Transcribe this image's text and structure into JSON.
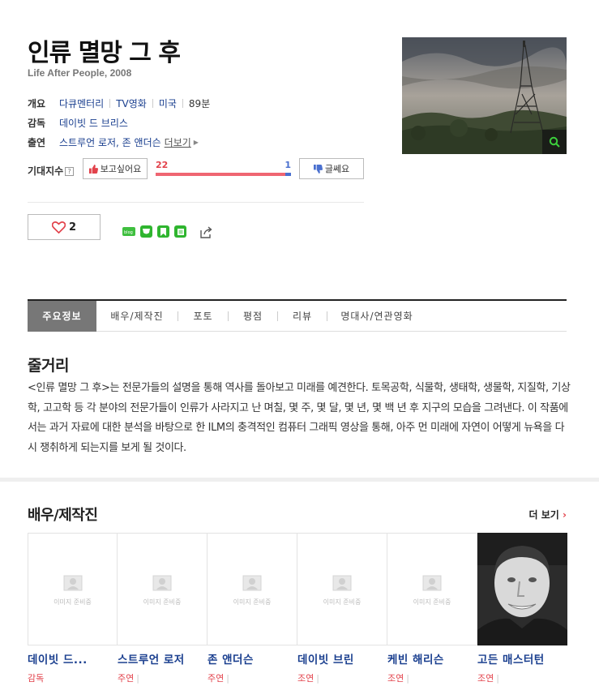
{
  "movie": {
    "title": "인류 멸망 그 후",
    "subtitle": "Life After People, 2008"
  },
  "info": {
    "overview_label": "개요",
    "genre": "다큐멘터리",
    "type": "TV영화",
    "country": "미국",
    "runtime": "89분",
    "director_label": "감독",
    "director": "데이빗 드 브리스",
    "cast_label": "출연",
    "cast": "스트루언 로저, 존 앤더슨",
    "more": "더보기"
  },
  "expect": {
    "label": "기대지수",
    "help": "?",
    "want_label": "보고싶어요",
    "want_count": "22",
    "meh_count": "1",
    "want_ratio": 0.957,
    "meh_label": "글쎄요"
  },
  "like": {
    "count": "2"
  },
  "tabs": [
    {
      "label": "주요정보"
    },
    {
      "label": "배우/제작진"
    },
    {
      "label": "포토"
    },
    {
      "label": "평점"
    },
    {
      "label": "리뷰"
    },
    {
      "label": "명대사/연관영화"
    }
  ],
  "synopsis": {
    "heading": "줄거리",
    "text": "<인류 멸망 그 후>는 전문가들의 설명을 통해 역사를 돌아보고 미래를 예견한다. 토목공학, 식물학, 생태학, 생물학, 지질학, 기상학, 고고학 등 각 분야의 전문가들이 인류가 사라지고 난 며칠, 몇 주, 몇 달, 몇 년, 몇 백 년 후 지구의 모습을 그려낸다. 이 작품에서는 과거 자료에 대한 분석을 바탕으로 한 ILM의 충격적인 컴퓨터 그래픽 영상을 통해, 아주 먼 미래에 자연이 어떻게 뉴욕을 다시 쟁취하게 되는지를 보게 될 것이다."
  },
  "cast_section": {
    "heading": "배우/제작진",
    "more": "더 보기",
    "placeholder": "이미지 준비중",
    "members": [
      {
        "name": "데이빗 드...",
        "role": "감독"
      },
      {
        "name": "스트루언 로저",
        "role": "주연"
      },
      {
        "name": "존 앤더슨",
        "role": "주연"
      },
      {
        "name": "데이빗 브린",
        "role": "조연"
      },
      {
        "name": "케빈 해리슨",
        "role": "조연"
      },
      {
        "name": "고든 매스터턴",
        "role": "조연"
      }
    ]
  }
}
